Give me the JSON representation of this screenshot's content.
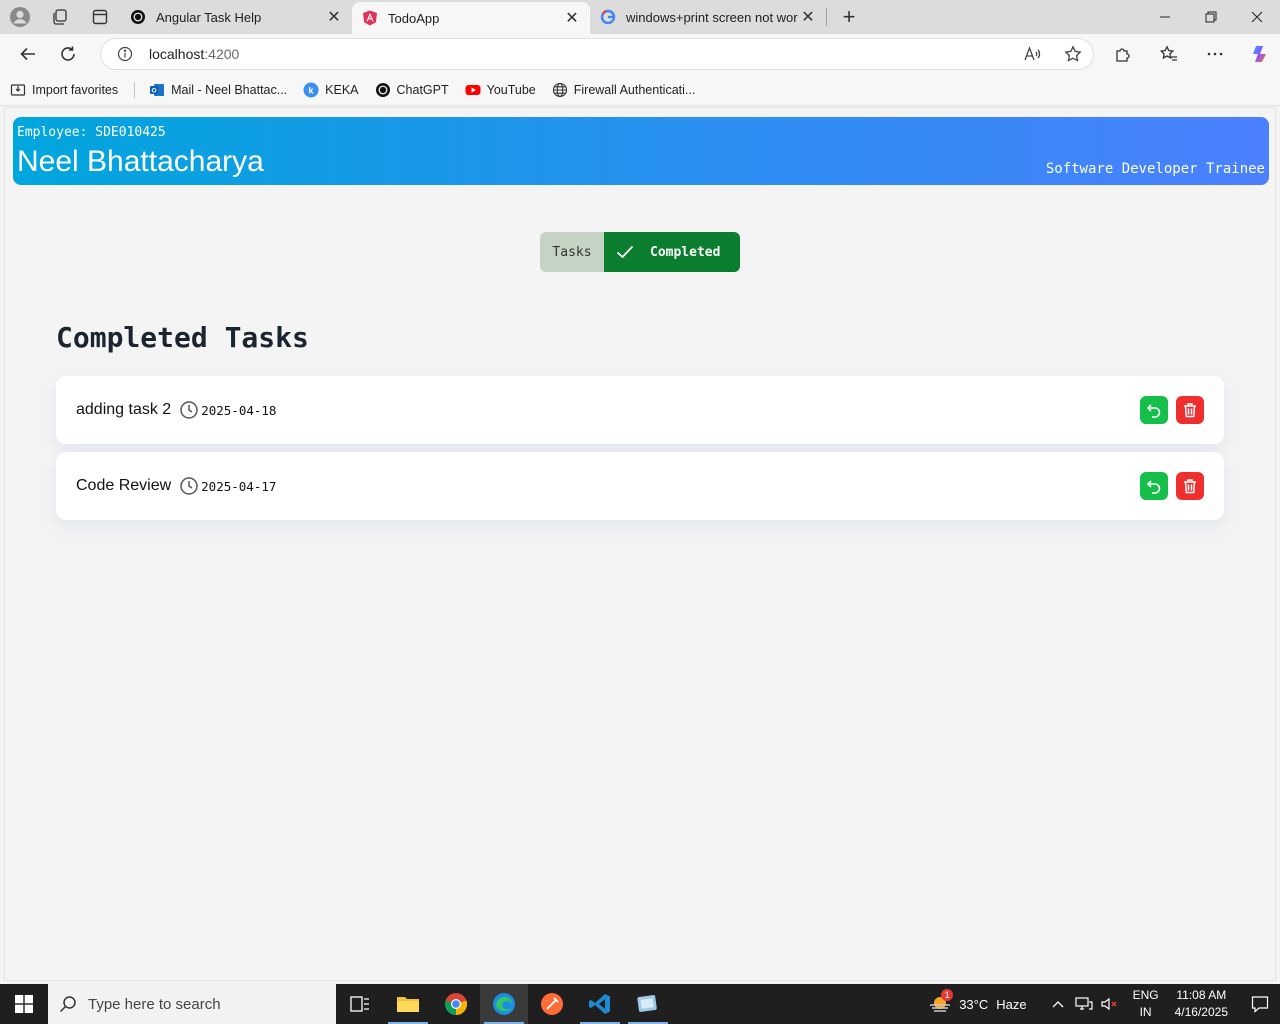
{
  "browser": {
    "tabs": [
      {
        "title": "Angular Task Help",
        "active": false
      },
      {
        "title": "TodoApp",
        "active": true
      },
      {
        "title": "windows+print screen not workin",
        "active": false
      }
    ],
    "url_host": "localhost",
    "url_port": ":4200",
    "favorites": [
      {
        "label": "Import favorites"
      },
      {
        "label": "Mail - Neel Bhattac..."
      },
      {
        "label": "KEKA"
      },
      {
        "label": "ChatGPT"
      },
      {
        "label": "YouTube"
      },
      {
        "label": "Firewall Authenticati..."
      }
    ]
  },
  "header": {
    "employee_id": "Employee: SDE010425",
    "name": "Neel Bhattacharya",
    "role": "Software Developer Trainee"
  },
  "toggle": {
    "tasks_label": "Tasks",
    "completed_label": "Completed"
  },
  "section_title": "Completed Tasks",
  "tasks": [
    {
      "name": "adding task 2",
      "date": "2025-04-18"
    },
    {
      "name": "Code Review",
      "date": "2025-04-17"
    }
  ],
  "taskbar": {
    "search_placeholder": "Type here to search",
    "temperature": "33°C",
    "weather": "Haze",
    "weather_badge": "1",
    "lang_1": "ENG",
    "lang_2": "IN",
    "time": "11:08 AM",
    "date": "4/16/2025"
  },
  "colors": {
    "header_gradient_start": "#00a6dc",
    "header_gradient_end": "#4b80ff",
    "completed_green": "#0a7e2e",
    "undo_green": "#15bf4a",
    "delete_red": "#ef2f2f"
  }
}
